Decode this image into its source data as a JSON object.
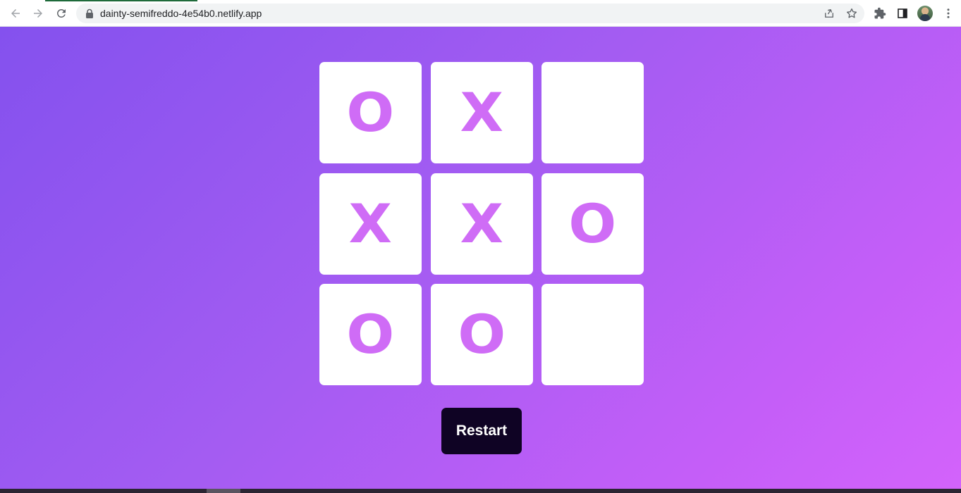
{
  "browser": {
    "url": "dainty-semifreddo-4e54b0.netlify.app",
    "icons": {
      "back": "arrow-left-icon",
      "forward": "arrow-right-icon",
      "reload": "reload-icon",
      "lock": "lock-icon",
      "share": "share-icon",
      "bookmark": "star-icon",
      "extensions": "puzzle-icon",
      "side_panel": "side-panel-icon",
      "menu": "kebab-menu-icon"
    }
  },
  "game": {
    "cells": [
      "O",
      "X",
      "",
      "X",
      "X",
      "O",
      "O",
      "O",
      ""
    ],
    "mark_color": "#cf6cf6",
    "restart_label": "Restart"
  },
  "colors": {
    "gradient_start": "#8451ee",
    "gradient_end": "#d363fb",
    "button_bg": "#0f0324"
  }
}
